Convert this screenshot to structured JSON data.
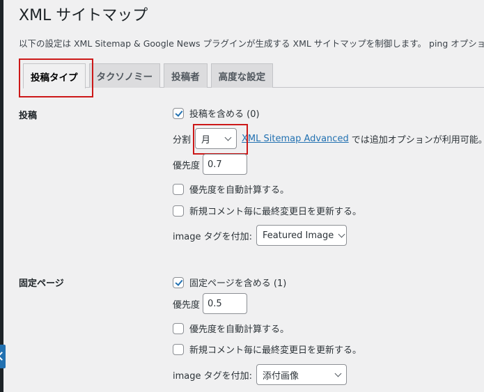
{
  "page": {
    "title": "XML サイトマップ",
    "description": "以下の設定は XML Sitemap & Google News プラグインが生成する XML サイトマップを制御します。 ping オプショ"
  },
  "tabs": [
    {
      "label": "投稿タイプ",
      "active": true
    },
    {
      "label": "タクソノミー",
      "active": false
    },
    {
      "label": "投稿者",
      "active": false
    },
    {
      "label": "高度な設定",
      "active": false
    }
  ],
  "sections": {
    "posts": {
      "label": "投稿",
      "include_label": "投稿を含める (0)",
      "include_checked": true,
      "split_label": "分割",
      "split_value": "月",
      "advanced_link": "XML Sitemap Advanced",
      "advanced_suffix": "では追加オプションが利用可能。",
      "priority_label": "優先度",
      "priority_value": "0.7",
      "auto_priority_label": "優先度を自動計算する。",
      "auto_priority_checked": false,
      "update_lastmod_label": "新規コメント毎に最終変更日を更新する。",
      "update_lastmod_checked": false,
      "image_tag_label": "image タグを付加:",
      "image_tag_value": "Featured Image"
    },
    "pages": {
      "label": "固定ページ",
      "include_label": "固定ページを含める (1)",
      "include_checked": true,
      "priority_label": "優先度",
      "priority_value": "0.5",
      "auto_priority_label": "優先度を自動計算する。",
      "auto_priority_checked": false,
      "update_lastmod_label": "新規コメント毎に最終変更日を更新する。",
      "update_lastmod_checked": false,
      "image_tag_label": "image タグを付加:",
      "image_tag_value": "添付画像"
    }
  },
  "colors": {
    "accent": "#2271b1",
    "highlight": "#cc1818",
    "background": "#f0f0f1"
  }
}
